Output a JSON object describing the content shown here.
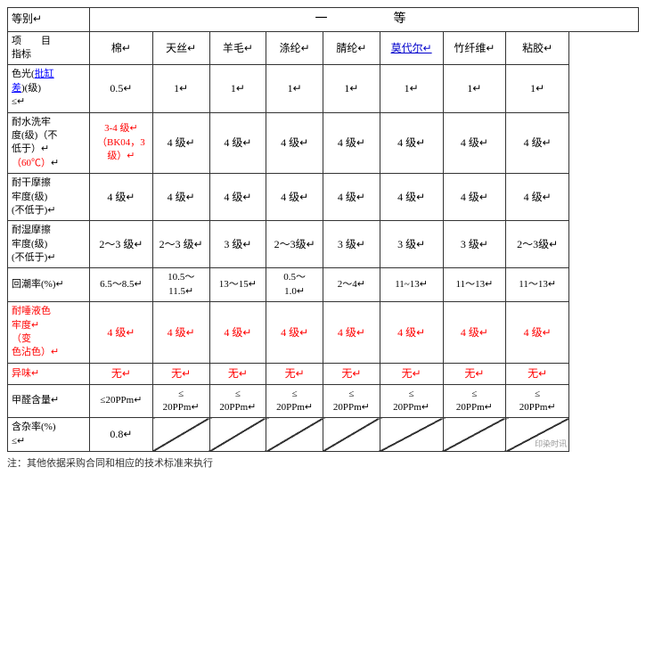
{
  "table": {
    "title": "一    等",
    "header_row": {
      "label_top": "等别",
      "label_bottom": "项    目\n指标",
      "cols": [
        "棉",
        "天丝",
        "羊毛",
        "涤纶",
        "腈纶",
        "莫代尔",
        "竹纤维",
        "粘胶"
      ]
    },
    "rows": [
      {
        "label": "色光(批缸差)(级)\n≤",
        "label_has_link": true,
        "link_text": "批缸差",
        "values": [
          "0.5",
          "1",
          "1",
          "1",
          "1",
          "1↵",
          "1",
          "1"
        ]
      },
      {
        "label": "耐水洗牢度(级)（不低于）↵（60℃）",
        "label_red_part": "（60℃）",
        "values_special": [
          {
            "text": "3-4 级↵（BK04，3级）↵",
            "red": true
          },
          {
            "text": "4 级",
            "red": false
          },
          {
            "text": "4 级",
            "red": false
          },
          {
            "text": "4 级",
            "red": false
          },
          {
            "text": "4 级",
            "red": false
          },
          {
            "text": "4 级",
            "red": false
          },
          {
            "text": "4 级",
            "red": false
          },
          {
            "text": "4 级",
            "red": false
          }
        ]
      },
      {
        "label": "耐干摩擦牢度(级)(不低于)",
        "values": [
          "4 级",
          "4 级",
          "4 级",
          "4 级",
          "4 级",
          "4 级",
          "4 级",
          "4 级"
        ]
      },
      {
        "label": "耐湿摩擦牢度(级)(不低于)",
        "values": [
          "2～3 级",
          "2～3 级",
          "3 级",
          "2～3级",
          "3 级",
          "3 级",
          "3 级",
          "2～3级"
        ]
      },
      {
        "label": "回潮率(%)",
        "values": [
          "6.5～8.5",
          "10.5～11.5",
          "13～15",
          "0.5～1.0",
          "2～4",
          "11~13",
          "11～13",
          "11～13"
        ]
      },
      {
        "label": "耐唾液色牢度↵（变色沾色）",
        "label_red": true,
        "values": [
          "4 级",
          "4 级",
          "4 级",
          "4 级",
          "4 级",
          "4 级",
          "4 级",
          "4 级"
        ],
        "values_red": true
      },
      {
        "label": "异味",
        "label_red": true,
        "values": [
          "无",
          "无",
          "无",
          "无",
          "无",
          "无",
          "无",
          "无"
        ],
        "values_red": true
      },
      {
        "label": "甲醛含量",
        "values": [
          "≤20PPm",
          "≤\n20PPm",
          "≤\n20PPm",
          "≤\n20PPm",
          "≤\n20PPm",
          "≤\n20PPm",
          "≤\n20PPm",
          "≤\n20PPm"
        ]
      },
      {
        "label": "含杂率(%)\n≤",
        "values": [
          "0.8",
          "",
          "",
          "",
          "",
          "",
          "",
          ""
        ],
        "last_is_watermark": true
      }
    ],
    "footnote": "注：其他依据采购合同和相应的技术标准来执行"
  },
  "watermark": "印染时讯"
}
